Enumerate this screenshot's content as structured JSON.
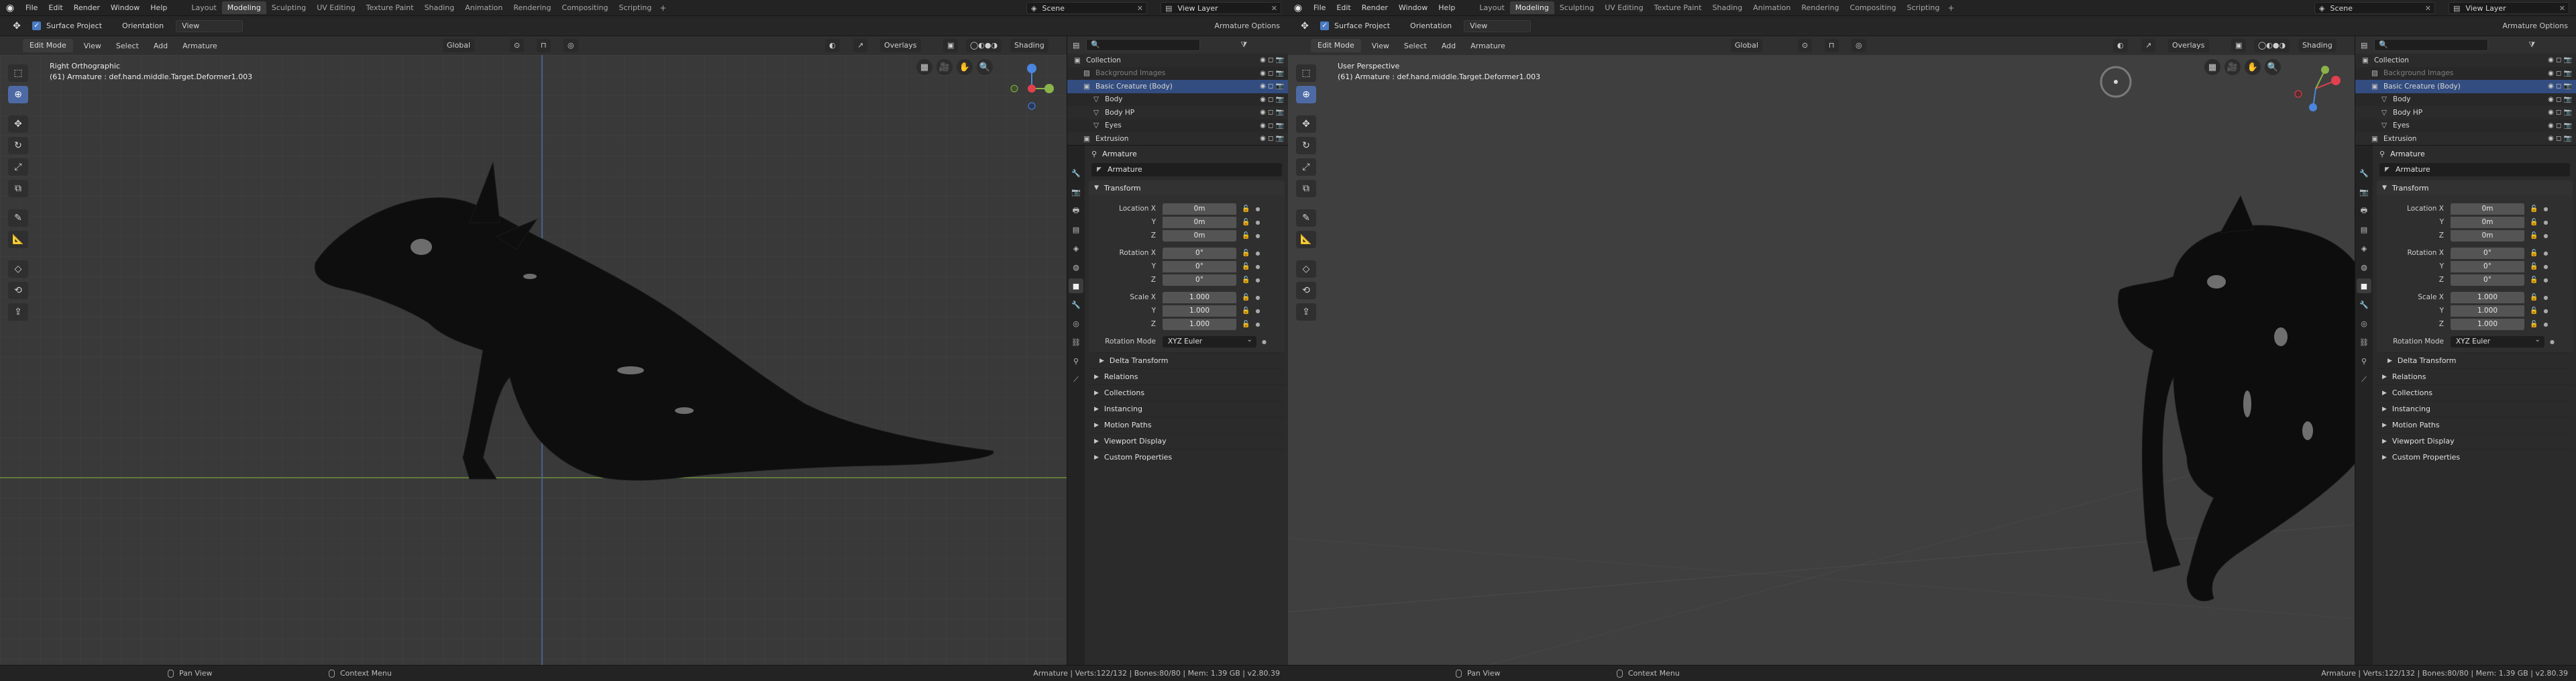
{
  "top_menu": [
    "File",
    "Edit",
    "Render",
    "Window",
    "Help"
  ],
  "workspaces": [
    "Layout",
    "Modeling",
    "Sculpting",
    "UV Editing",
    "Texture Paint",
    "Shading",
    "Animation",
    "Rendering",
    "Compositing",
    "Scripting"
  ],
  "active_workspace": "Modeling",
  "scene_label": "Scene",
  "view_layer_label": "View Layer",
  "tool_header": {
    "surface_project": "Surface Project",
    "orientation": "Orientation",
    "orientation_value": "View",
    "armature_options": "Armature Options"
  },
  "viewport_header": {
    "mode": "Edit Mode",
    "menus": [
      "View",
      "Select",
      "Add",
      "Armature"
    ],
    "transform": "Global",
    "overlays": "Overlays",
    "shading": "Shading"
  },
  "left_viewport": {
    "view_name": "Right Orthographic",
    "object_info": "(61) Armature : def.hand.middle.Target.Deformer1.003"
  },
  "right_viewport": {
    "view_name": "User Perspective",
    "object_info": "(61) Armature : def.hand.middle.Target.Deformer1.003"
  },
  "outliner": {
    "rows": [
      {
        "label": "Collection",
        "indent": 0,
        "selected": false,
        "dim": false
      },
      {
        "label": "Background Images",
        "indent": 1,
        "selected": false,
        "dim": true
      },
      {
        "label": "Basic Creature (Body)",
        "indent": 1,
        "selected": true,
        "dim": false
      },
      {
        "label": "Body",
        "indent": 2,
        "selected": false,
        "dim": false
      },
      {
        "label": "Body HP",
        "indent": 2,
        "selected": false,
        "dim": false
      },
      {
        "label": "Eyes",
        "indent": 2,
        "selected": false,
        "dim": false
      },
      {
        "label": "Extrusion",
        "indent": 1,
        "selected": false,
        "dim": false
      }
    ]
  },
  "properties": {
    "header": "Armature",
    "name": "Armature",
    "transform_label": "Transform",
    "location": {
      "label_x": "Location X",
      "label_y": "Y",
      "label_z": "Z",
      "x": "0m",
      "y": "0m",
      "z": "0m"
    },
    "rotation": {
      "label_x": "Rotation X",
      "label_y": "Y",
      "label_z": "Z",
      "x": "0°",
      "y": "0°",
      "z": "0°"
    },
    "scale": {
      "label_x": "Scale X",
      "label_y": "Y",
      "label_z": "Z",
      "x": "1.000",
      "y": "1.000",
      "z": "1.000"
    },
    "rotation_mode_label": "Rotation Mode",
    "rotation_mode": "XYZ Euler",
    "delta_transform": "Delta Transform",
    "collapsed_panels": [
      "Relations",
      "Collections",
      "Instancing",
      "Motion Paths",
      "Viewport Display",
      "Custom Properties"
    ]
  },
  "status_bar": {
    "pan_view": "Pan View",
    "context_menu": "Context Menu",
    "stats": "Armature | Verts:122/132 | Bones:80/80 | Mem: 1.39 GB | v2.80.39"
  },
  "colors": {
    "selection": "#334d80",
    "accent_blue": "#4d6aa5",
    "axis_green": "#8ab34a",
    "axis_red": "#e0404f",
    "axis_blue": "#4a86e0",
    "grid_line": "#3f3f3f",
    "viewport_bg": "#393939",
    "right_viewport_bg": "#3f3f3f"
  },
  "icons": {
    "blender_logo": "blender-logo-icon",
    "cursor": "cursor-icon",
    "select_box": "select-box-icon",
    "move": "move-icon",
    "rotate": "rotate-icon",
    "scale": "scale-icon",
    "annotate": "annotate-icon",
    "measure": "measure-icon",
    "extrude": "extrude-icon",
    "roll": "roll-icon",
    "bone_size": "bone-size-icon"
  }
}
